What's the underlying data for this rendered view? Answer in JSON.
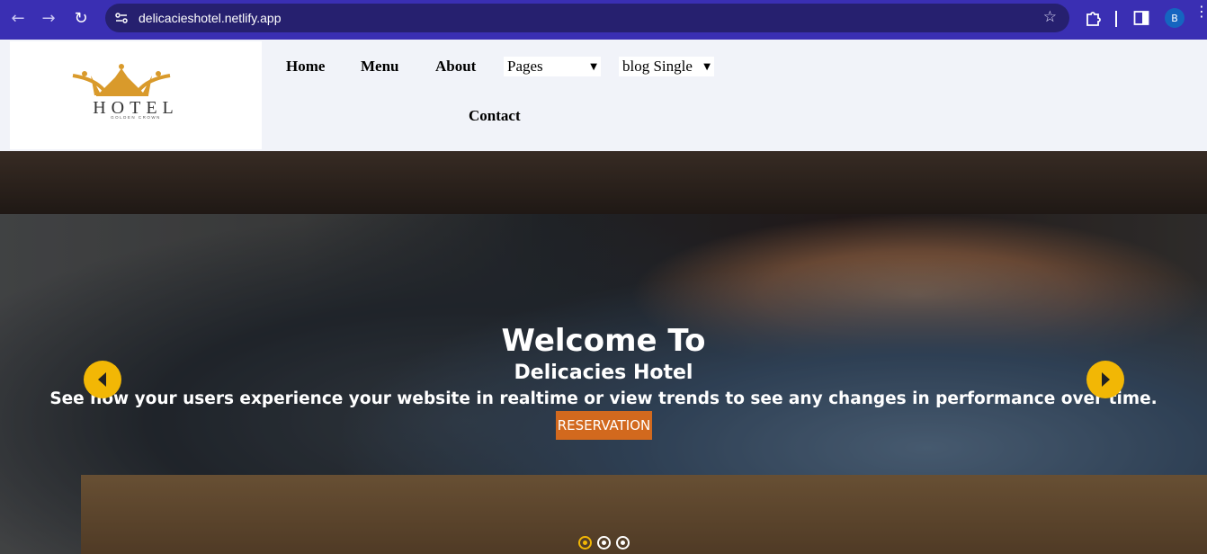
{
  "browser": {
    "url": "delicacieshotel.netlify.app",
    "profile_initial": "B",
    "icons": [
      "back-arrow-icon",
      "forward-arrow-icon",
      "reload-icon",
      "site-settings-icon",
      "bookmark-star-icon",
      "extensions-icon",
      "side-panel-icon",
      "menu-dots-icon"
    ]
  },
  "header": {
    "logo_text": "HOTEL",
    "logo_tagline": "GOLDEN CROWN",
    "nav": {
      "home": "Home",
      "menu": "Menu",
      "about": "About",
      "pages_select": "Pages",
      "blog_select": "blog Single",
      "contact": "Contact"
    }
  },
  "hero": {
    "title": "Welcome To",
    "subtitle": "Delicacies Hotel",
    "text": "See how your users experience your website in realtime or view trends to see any changes in performance over time.",
    "button": "RESERVATION",
    "slide_count": 3,
    "active_slide": 1
  },
  "colors": {
    "browser_frame": "#3a2fb3",
    "url_bar": "#26206f",
    "accent_yellow": "#f2b705",
    "button_orange": "#d2691e",
    "logo_gold": "#d99a2b"
  }
}
